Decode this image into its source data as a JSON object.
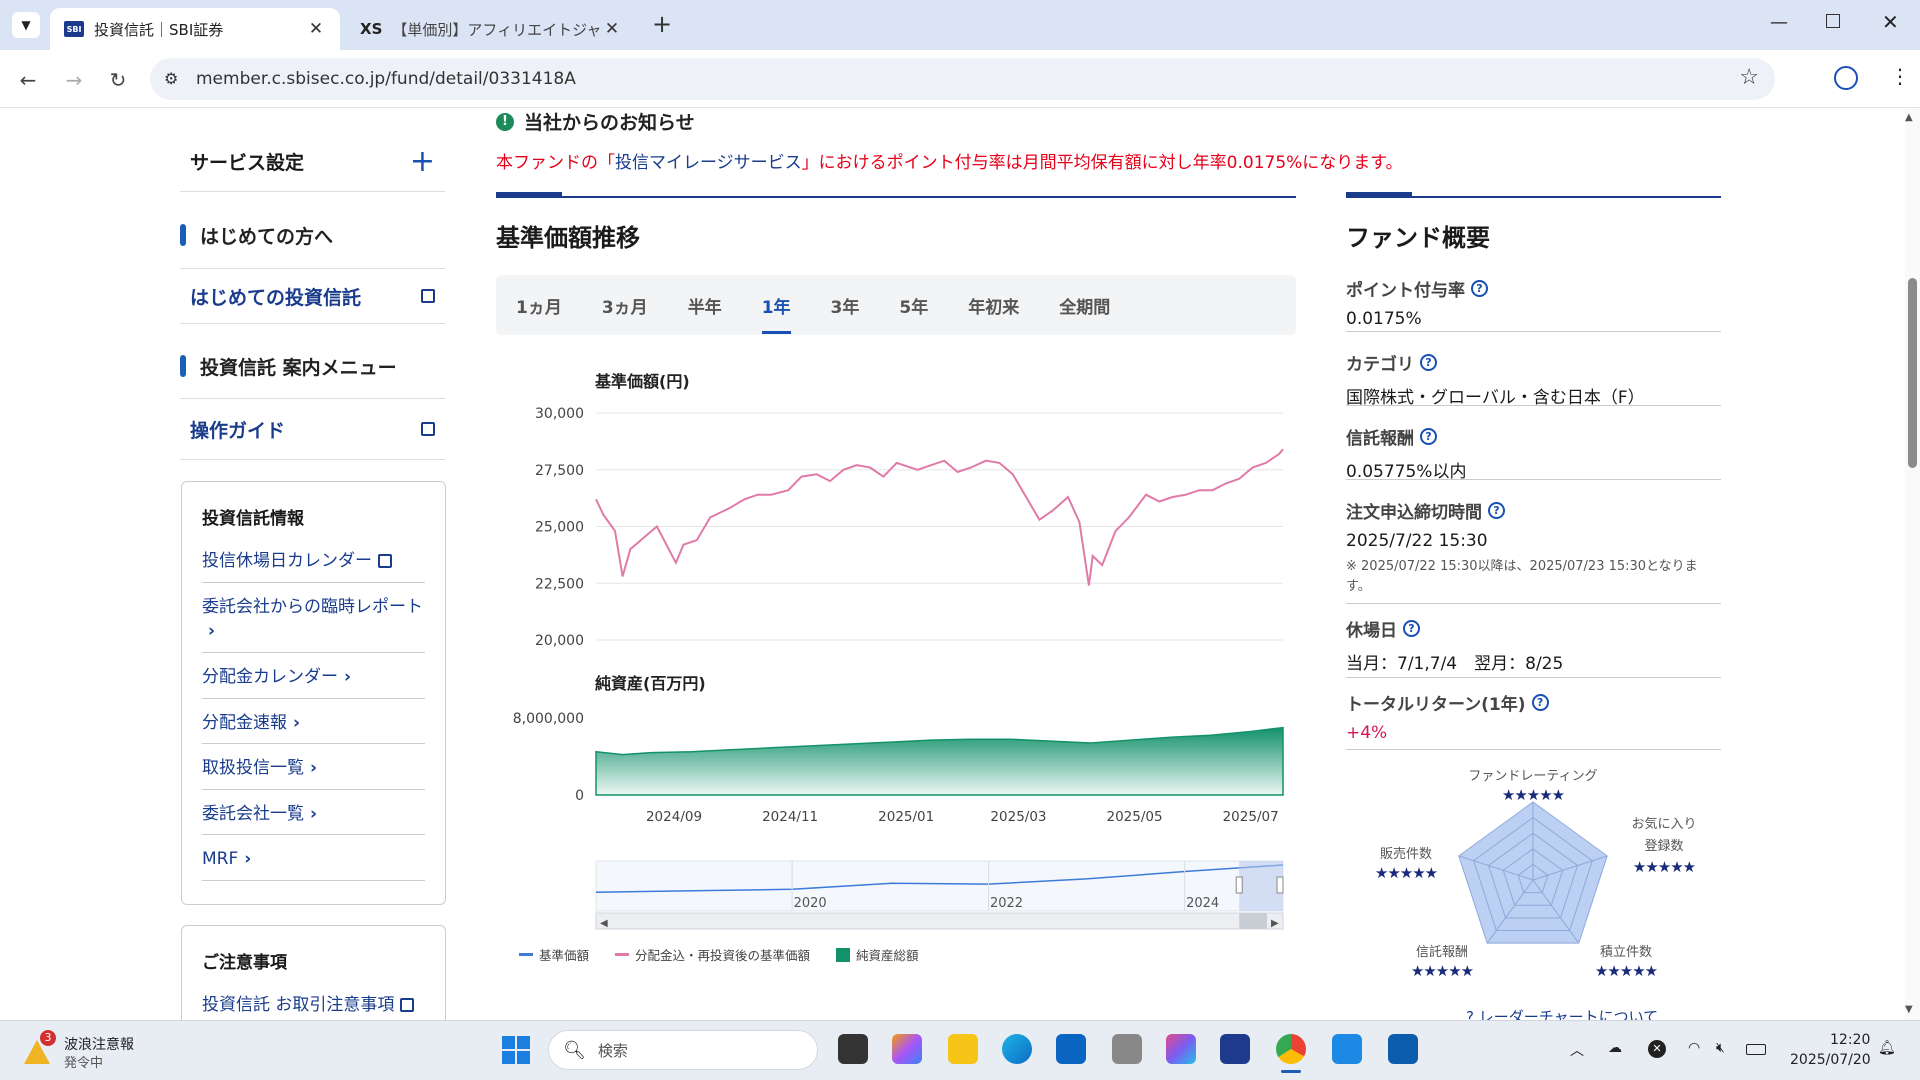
{
  "browser": {
    "tabs": [
      {
        "favicon": "SBI",
        "title": "投資信託｜SBI証券"
      },
      {
        "favicon": "XS",
        "title": "【単価別】アフィリエイトジャンル17選"
      }
    ],
    "url": "member.c.sbisec.co.jp/fund/detail/0331418A"
  },
  "sidebar": {
    "service_settings": "サービス設定",
    "for_beginners": "はじめての方へ",
    "first_investment_trust": "はじめての投資信託",
    "trust_menu": "投資信託 案内メニュー",
    "operation_guide": "操作ガイド",
    "info_box": {
      "title": "投資信託情報",
      "items": [
        "投信休場日カレンダー",
        "委託会社からの臨時レポート",
        "分配金カレンダー",
        "分配金速報",
        "取扱投信一覧",
        "委託会社一覧",
        "MRF"
      ]
    },
    "caution_box": {
      "title": "ご注意事項",
      "items": [
        "投資信託 お取引注意事項"
      ]
    }
  },
  "notice": {
    "title": "当社からのお知らせ",
    "text_prefix": "本ファンドの「",
    "link": "投信マイレージサービス",
    "text_suffix": "」におけるポイント付与率は月間平均保有額に対し年率0.0175%になります。"
  },
  "price_section": {
    "title": "基準価額推移",
    "periods": [
      "1ヵ月",
      "3ヵ月",
      "半年",
      "1年",
      "3年",
      "5年",
      "年初来",
      "全期間"
    ],
    "active_period": "1年"
  },
  "chart_data": [
    {
      "type": "line",
      "title": "基準価額(円)",
      "ylim": [
        20000,
        30000
      ],
      "yticks": [
        "30,000",
        "27,500",
        "25,000",
        "22,500",
        "20,000"
      ],
      "x_ticks": [
        "2024/09",
        "2024/11",
        "2025/01",
        "2025/03",
        "2025/05",
        "2025/07"
      ],
      "series": [
        {
          "name": "分配金込・再投資後の基準価額",
          "color": "#e07aa8",
          "x": [
            "2024/07/22",
            "2024/07/26",
            "2024/08/01",
            "2024/08/05",
            "2024/08/09",
            "2024/08/16",
            "2024/08/23",
            "2024/09/02",
            "2024/09/06",
            "2024/09/13",
            "2024/09/20",
            "2024/09/30",
            "2024/10/08",
            "2024/10/15",
            "2024/10/22",
            "2024/10/31",
            "2024/11/07",
            "2024/11/15",
            "2024/11/22",
            "2024/11/29",
            "2024/12/06",
            "2024/12/13",
            "2024/12/20",
            "2024/12/27",
            "2025/01/07",
            "2025/01/14",
            "2025/01/21",
            "2025/01/28",
            "2025/02/04",
            "2025/02/12",
            "2025/02/19",
            "2025/02/26",
            "2025/03/05",
            "2025/03/12",
            "2025/03/19",
            "2025/03/27",
            "2025/04/02",
            "2025/04/07",
            "2025/04/09",
            "2025/04/14",
            "2025/04/21",
            "2025/04/28",
            "2025/05/07",
            "2025/05/14",
            "2025/05/21",
            "2025/05/28",
            "2025/06/04",
            "2025/06/11",
            "2025/06/18",
            "2025/06/25",
            "2025/07/02",
            "2025/07/09",
            "2025/07/16",
            "2025/07/18"
          ],
          "values": [
            26200,
            25500,
            24800,
            22800,
            24000,
            24500,
            25000,
            23400,
            24200,
            24400,
            25400,
            25800,
            26200,
            26400,
            26400,
            26600,
            27200,
            27300,
            27000,
            27500,
            27700,
            27600,
            27200,
            27800,
            27500,
            27700,
            27900,
            27400,
            27600,
            27900,
            27800,
            27300,
            26300,
            25300,
            25700,
            26300,
            25200,
            22400,
            23700,
            23300,
            24800,
            25400,
            26400,
            26100,
            26300,
            26400,
            26600,
            26600,
            26900,
            27100,
            27600,
            27800,
            28200,
            28400
          ]
        }
      ]
    },
    {
      "type": "area",
      "title": "純資産(百万円)",
      "ylim": [
        0,
        8000000
      ],
      "yticks": [
        "8,000,000",
        "0"
      ],
      "series": [
        {
          "name": "純資産総額",
          "color": "#12916a",
          "x": [
            "2024/07/22",
            "2024/08/05",
            "2024/08/20",
            "2024/09/10",
            "2024/10/01",
            "2024/10/22",
            "2024/11/12",
            "2024/12/03",
            "2024/12/24",
            "2025/01/14",
            "2025/02/04",
            "2025/02/25",
            "2025/03/18",
            "2025/04/08",
            "2025/04/29",
            "2025/05/20",
            "2025/06/10",
            "2025/07/01",
            "2025/07/18"
          ],
          "values": [
            4500000,
            4200000,
            4400000,
            4500000,
            4700000,
            4900000,
            5100000,
            5300000,
            5500000,
            5700000,
            5800000,
            5800000,
            5600000,
            5400000,
            5700000,
            6000000,
            6200000,
            6600000,
            7000000
          ]
        }
      ]
    },
    {
      "type": "area",
      "title": "",
      "x_ticks": [
        "2020",
        "2022",
        "2024"
      ],
      "series": [
        {
          "name": "基準価額",
          "color": "#3d7bd9",
          "x": [
            "2018",
            "2019",
            "2020",
            "2021",
            "2022",
            "2023",
            "2024",
            "2025"
          ],
          "values": [
            10000,
            11000,
            12000,
            16000,
            15500,
            19000,
            24000,
            28400
          ]
        }
      ]
    }
  ],
  "legend": [
    {
      "label": "基準価額",
      "color": "#3d7bd9",
      "kind": "line"
    },
    {
      "label": "分配金込・再投資後の基準価額",
      "color": "#e07aa8",
      "kind": "line"
    },
    {
      "label": "純資産総額",
      "color": "#12916a",
      "kind": "square"
    }
  ],
  "overview": {
    "title": "ファンド概要",
    "items": [
      {
        "label": "ポイント付与率",
        "value": "0.0175%"
      },
      {
        "label": "カテゴリ",
        "value": "国際株式・グローバル・含む日本（F）"
      },
      {
        "label": "信託報酬",
        "value": "0.05775%以内"
      },
      {
        "label": "注文申込締切時間",
        "value": "2025/7/22 15:30",
        "note": "※ 2025/07/22 15:30以降は、2025/07/23 15:30となります。"
      },
      {
        "label": "休場日",
        "value": "当月：7/1,7/4　翌月：8/25"
      },
      {
        "label": "トータルリターン(1年)",
        "value": "+4%"
      }
    ],
    "radar": {
      "labels": [
        "ファンドレーティング",
        "お気に入り登録数",
        "積立件数",
        "信託報酬",
        "販売件数"
      ],
      "stars": [
        5,
        5,
        5,
        5,
        5
      ],
      "link": "レーダーチャートについて"
    }
  },
  "taskbar": {
    "weather_badge": "3",
    "weather_title": "波浪注意報",
    "weather_sub": "発令中",
    "search_placeholder": "検索",
    "time": "12:20",
    "date": "2025/07/20"
  }
}
